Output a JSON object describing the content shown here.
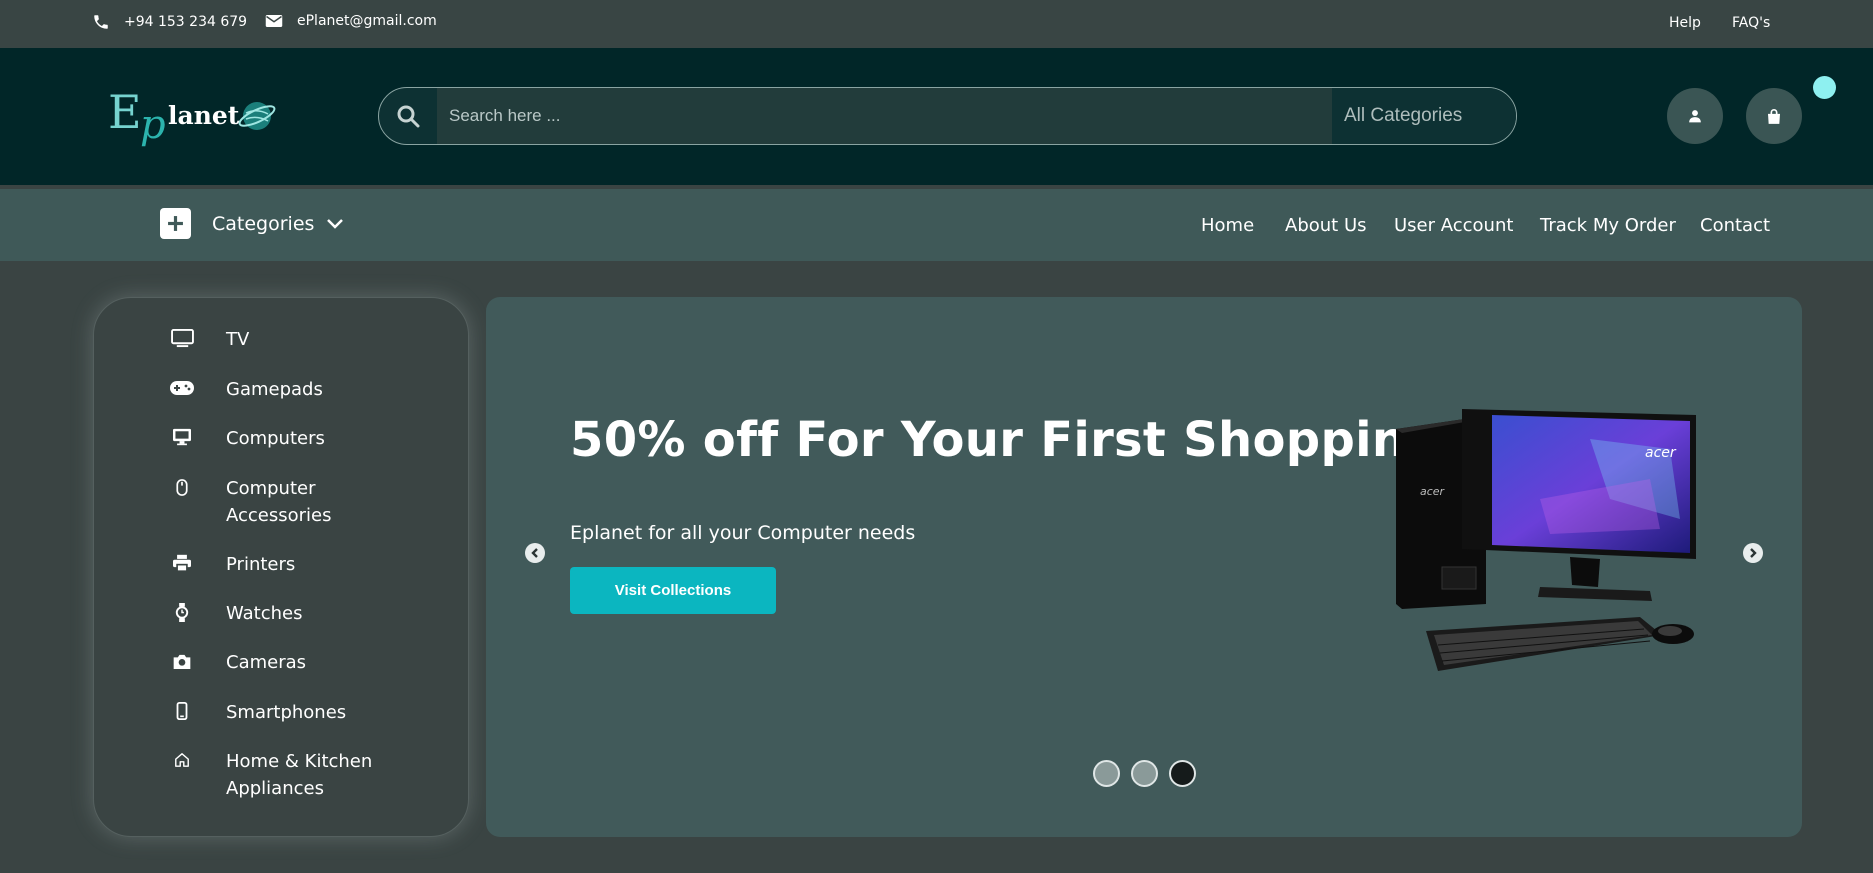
{
  "topbar": {
    "phone": "+94 153 234 679",
    "email": "ePlanet@gmail.com",
    "help": "Help",
    "faq": "FAQ's"
  },
  "header": {
    "logo_text": "EPlanet",
    "search": {
      "placeholder": "Search here ...",
      "category": "All Categories"
    }
  },
  "nav": {
    "categories_label": "Categories",
    "links": [
      "Home",
      "About Us",
      "User Account",
      "Track My Order",
      "Contact"
    ]
  },
  "sidebar": {
    "items": [
      {
        "label": "TV",
        "icon": "tv-icon"
      },
      {
        "label": "Gamepads",
        "icon": "gamepad-icon"
      },
      {
        "label": "Computers",
        "icon": "desktop-icon"
      },
      {
        "label": "Computer Accessories",
        "icon": "mouse-icon"
      },
      {
        "label": "Printers",
        "icon": "printer-icon"
      },
      {
        "label": "Watches",
        "icon": "watch-icon"
      },
      {
        "label": "Cameras",
        "icon": "camera-icon"
      },
      {
        "label": "Smartphones",
        "icon": "smartphone-icon"
      },
      {
        "label": "Home & Kitchen Appliances",
        "icon": "home-icon"
      }
    ]
  },
  "hero": {
    "title": "50% off For Your First Shopping",
    "subtitle": "Eplanet for all your Computer needs",
    "button": "Visit Collections",
    "product_brand": "acer",
    "slides": 3,
    "active_slide": 3
  },
  "colors": {
    "accent": "#0bb6c0",
    "header_bg": "#012628",
    "nav_bg": "#3f5958",
    "hero_bg": "#415a5a",
    "cart_badge": "#8ef0f0"
  }
}
